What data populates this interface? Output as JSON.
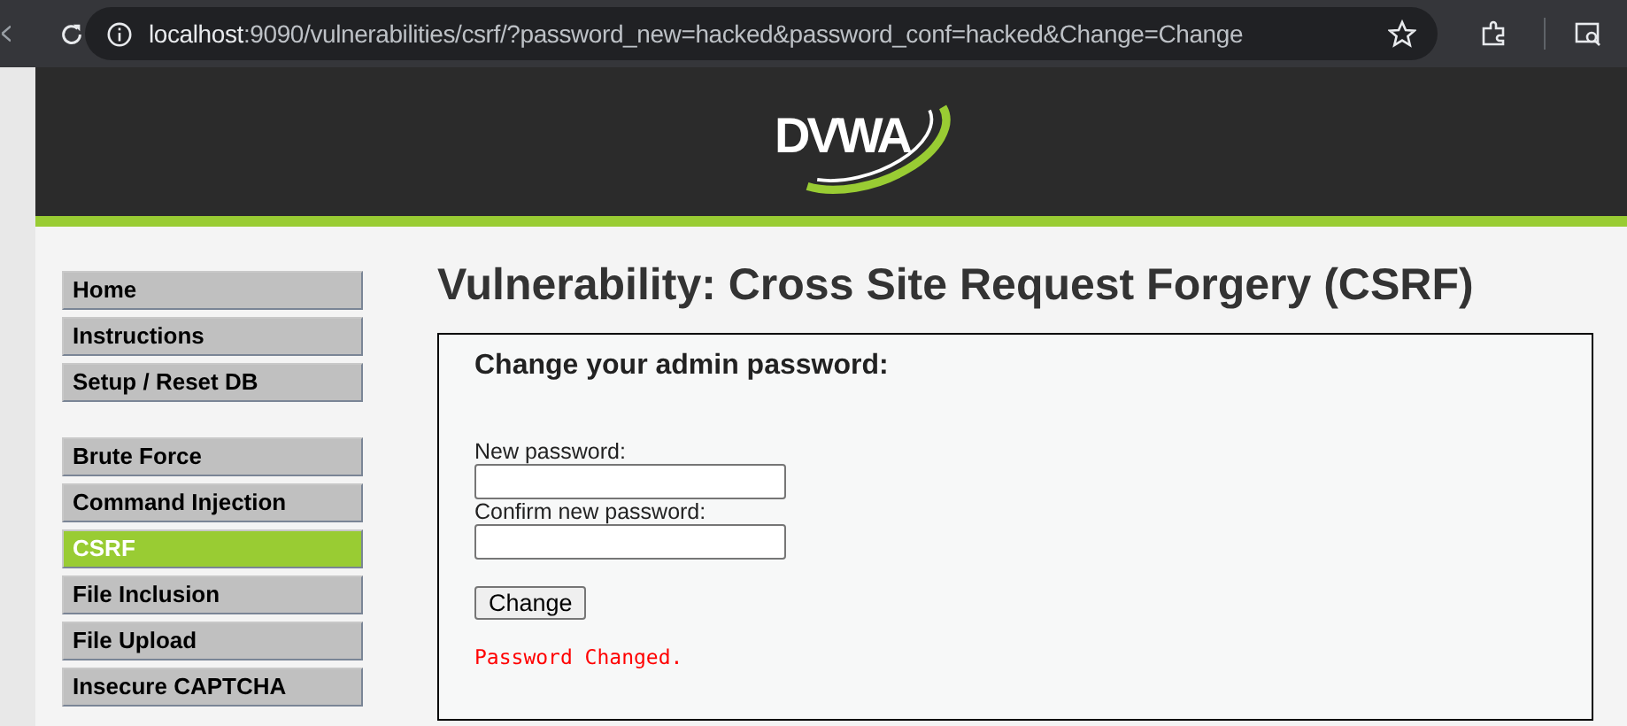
{
  "browser": {
    "url_host": "localhost",
    "url_rest": ":9090/vulnerabilities/csrf/?password_new=hacked&password_conf=hacked&Change=Change"
  },
  "header": {
    "logo": "DVWA"
  },
  "menu_groups": [
    [
      {
        "label": "Home",
        "selected": false
      },
      {
        "label": "Instructions",
        "selected": false
      },
      {
        "label": "Setup / Reset DB",
        "selected": false
      }
    ],
    [
      {
        "label": "Brute Force",
        "selected": false
      },
      {
        "label": "Command Injection",
        "selected": false
      },
      {
        "label": "CSRF",
        "selected": true
      },
      {
        "label": "File Inclusion",
        "selected": false
      },
      {
        "label": "File Upload",
        "selected": false
      },
      {
        "label": "Insecure CAPTCHA",
        "selected": false
      }
    ]
  ],
  "title": "Vulnerability: Cross Site Request Forgery (CSRF)",
  "form": {
    "heading": "Change your admin password:",
    "fields": [
      {
        "label": "New password:"
      },
      {
        "label": "Confirm new password:"
      }
    ],
    "button": "Change",
    "message": "Password Changed."
  }
}
